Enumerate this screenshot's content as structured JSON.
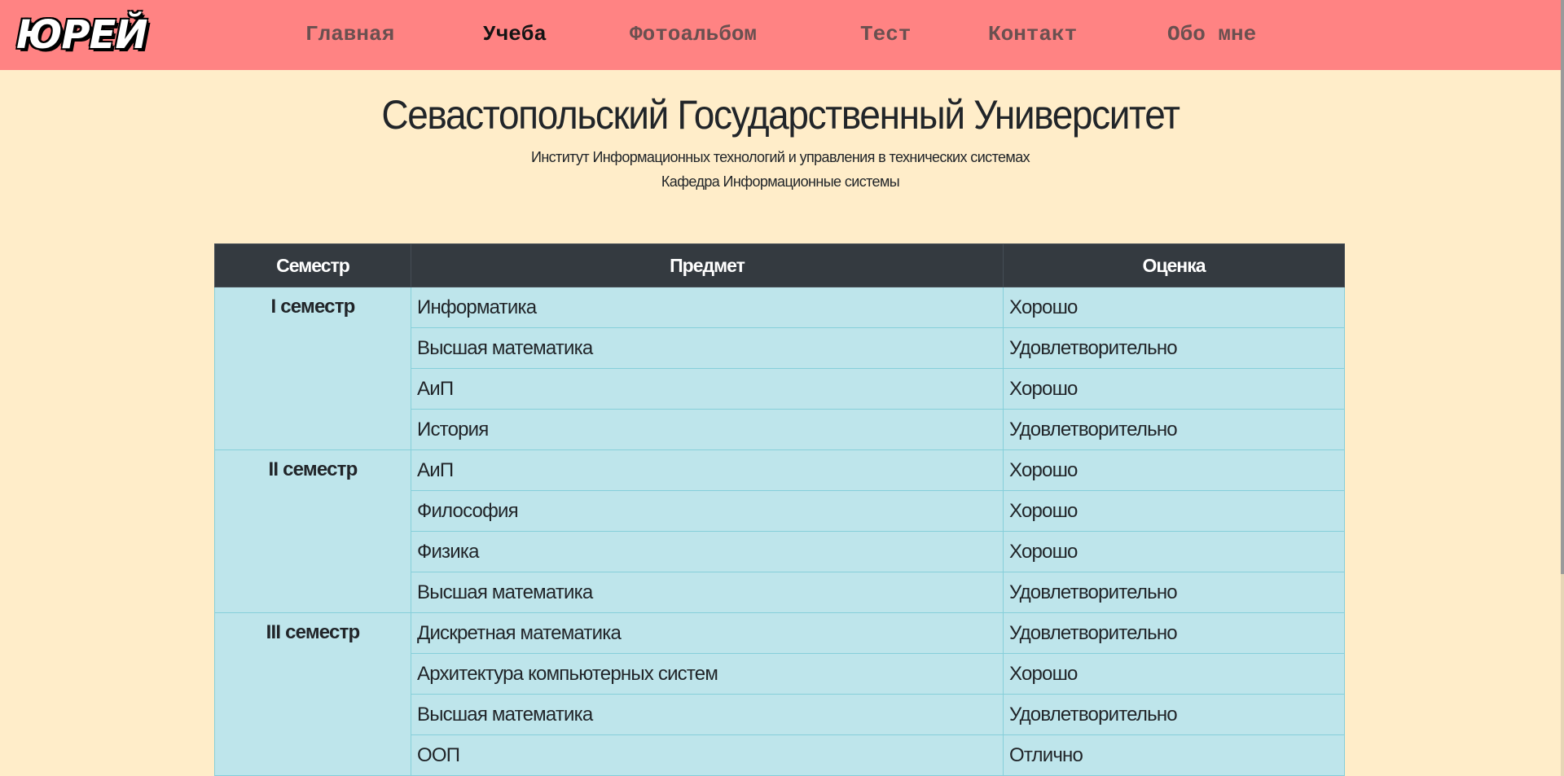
{
  "nav": {
    "logo": "ЮРЕЙ",
    "links": [
      {
        "label": "Главная"
      },
      {
        "label": "Учеба"
      },
      {
        "label": "Фотоальбом"
      },
      {
        "label": "Тест"
      },
      {
        "label": "Контакт"
      },
      {
        "label": "Обо мне"
      }
    ],
    "active": "Учеба"
  },
  "header": {
    "title": "Севастопольский Государственный Университет",
    "institute": "Институт Информационных технологий и управления в технических системах",
    "department": "Кафедра Информационные системы"
  },
  "table": {
    "columns": [
      "Семестр",
      "Предмет",
      "Оценка"
    ],
    "semesters": [
      {
        "name": "I семестр",
        "rows": [
          {
            "subject": "Информатика",
            "grade": "Хорошо"
          },
          {
            "subject": "Высшая математика",
            "grade": "Удовлетворительно"
          },
          {
            "subject": "АиП",
            "grade": "Хорошо"
          },
          {
            "subject": "История",
            "grade": "Удовлетворительно"
          }
        ]
      },
      {
        "name": "II семестр",
        "rows": [
          {
            "subject": "АиП",
            "grade": "Хорошо"
          },
          {
            "subject": "Философия",
            "grade": "Хорошо"
          },
          {
            "subject": "Физика",
            "grade": "Хорошо"
          },
          {
            "subject": "Высшая математика",
            "grade": "Удовлетворительно"
          }
        ]
      },
      {
        "name": "III семестр",
        "rows": [
          {
            "subject": "Дискретная математика",
            "grade": "Удовлетворительно"
          },
          {
            "subject": "Архитектура компьютерных систем",
            "grade": "Хорошо"
          },
          {
            "subject": "Высшая математика",
            "grade": "Удовлетворительно"
          },
          {
            "subject": "ООП",
            "grade": "Отлично"
          }
        ]
      }
    ]
  },
  "colors": {
    "page_background": "#ffedc9",
    "navbar": "#ff8383",
    "table_header": "#343a40",
    "table_cell": "#bee5eb"
  }
}
